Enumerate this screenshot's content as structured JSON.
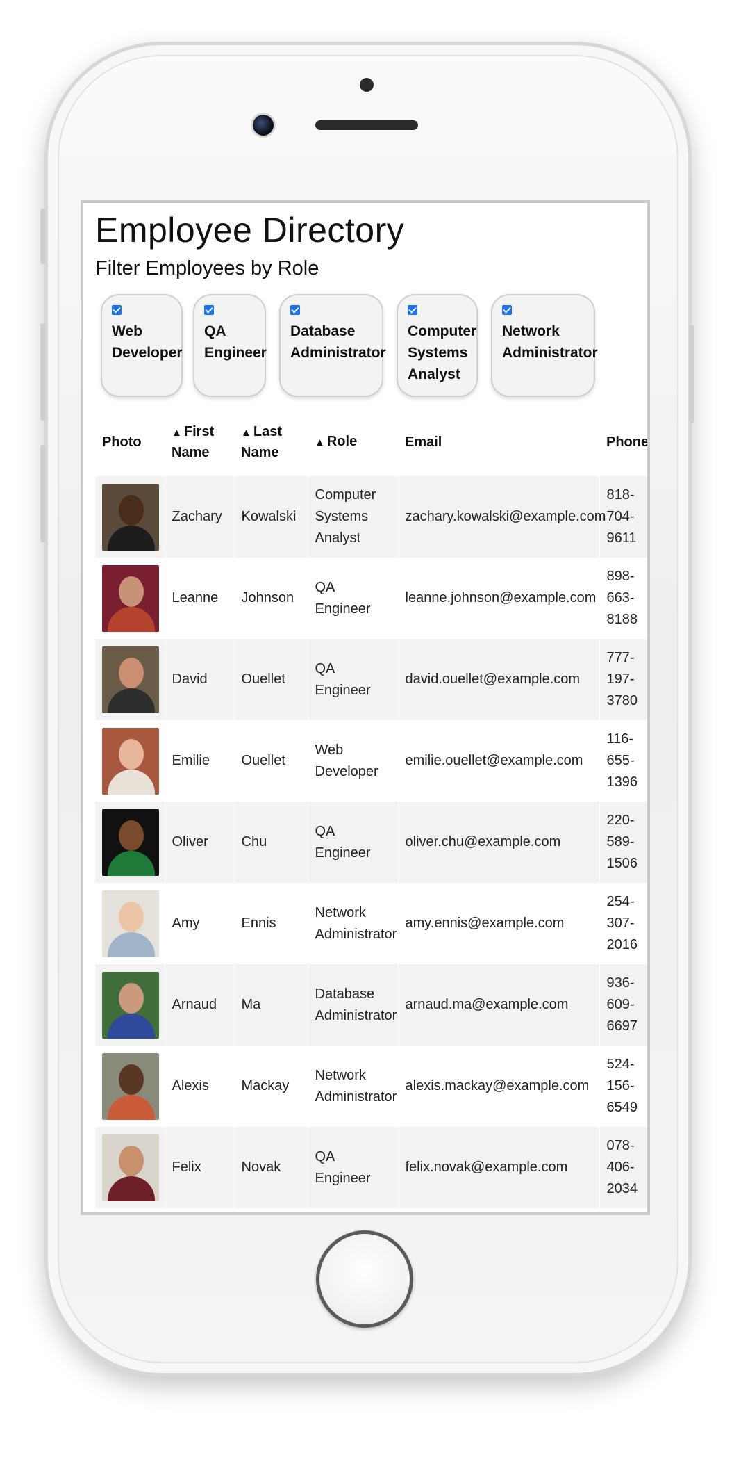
{
  "page": {
    "title": "Employee Directory",
    "subtitle": "Filter Employees by Role"
  },
  "filters": [
    {
      "lines": [
        "Web",
        "Developer"
      ],
      "checked": true
    },
    {
      "lines": [
        "QA",
        "Engineer"
      ],
      "checked": true
    },
    {
      "lines": [
        "Database",
        "Administrator"
      ],
      "checked": true
    },
    {
      "lines": [
        "Computer",
        "Systems",
        "Analyst"
      ],
      "checked": true
    },
    {
      "lines": [
        "Network",
        "Administrator"
      ],
      "checked": true
    }
  ],
  "table": {
    "headers": {
      "photo": "Photo",
      "first_name": [
        "First",
        "Name"
      ],
      "last_name": [
        "Last",
        "Name"
      ],
      "role": "Role",
      "email": "Email",
      "phone": "Phone"
    },
    "sort_icon": "sort-icon",
    "rows": [
      {
        "first": "Zachary",
        "last": "Kowalski",
        "role": [
          "Computer",
          "Systems",
          "Analyst"
        ],
        "email": "zachary.kowalski@example.com",
        "phone": [
          "818-",
          "704-",
          "9611"
        ],
        "colors": {
          "bg": "#5b4a3a",
          "skin": "#4a2c1c",
          "shirt": "#1d1d1d"
        }
      },
      {
        "first": "Leanne",
        "last": "Johnson",
        "role": [
          "QA Engineer"
        ],
        "email": "leanne.johnson@example.com",
        "phone": [
          "898-",
          "663-",
          "8188"
        ],
        "colors": {
          "bg": "#7a1f32",
          "skin": "#c79177",
          "shirt": "#b5422c"
        }
      },
      {
        "first": "David",
        "last": "Ouellet",
        "role": [
          "QA Engineer"
        ],
        "email": "david.ouellet@example.com",
        "phone": [
          "777-",
          "197-",
          "3780"
        ],
        "colors": {
          "bg": "#6a5a48",
          "skin": "#c98f70",
          "shirt": "#2e2e2e"
        }
      },
      {
        "first": "Emilie",
        "last": "Ouellet",
        "role": [
          "Web",
          "Developer"
        ],
        "email": "emilie.ouellet@example.com",
        "phone": [
          "116-",
          "655-",
          "1396"
        ],
        "colors": {
          "bg": "#a8583e",
          "skin": "#e6b59a",
          "shirt": "#e9e1d8"
        }
      },
      {
        "first": "Oliver",
        "last": "Chu",
        "role": [
          "QA Engineer"
        ],
        "email": "oliver.chu@example.com",
        "phone": [
          "220-",
          "589-",
          "1506"
        ],
        "colors": {
          "bg": "#111111",
          "skin": "#7a4a2c",
          "shirt": "#1f7a3a"
        }
      },
      {
        "first": "Amy",
        "last": "Ennis",
        "role": [
          "Network",
          "Administrator"
        ],
        "email": "amy.ennis@example.com",
        "phone": [
          "254-",
          "307-",
          "2016"
        ],
        "colors": {
          "bg": "#e4e0da",
          "skin": "#ecc4a6",
          "shirt": "#9fb4c8"
        }
      },
      {
        "first": "Arnaud",
        "last": "Ma",
        "role": [
          "Database",
          "Administrator"
        ],
        "email": "arnaud.ma@example.com",
        "phone": [
          "936-",
          "609-",
          "6697"
        ],
        "colors": {
          "bg": "#3f6e3a",
          "skin": "#c99a7c",
          "shirt": "#2f4a9a"
        }
      },
      {
        "first": "Alexis",
        "last": "Mackay",
        "role": [
          "Network",
          "Administrator"
        ],
        "email": "alexis.mackay@example.com",
        "phone": [
          "524-",
          "156-",
          "6549"
        ],
        "colors": {
          "bg": "#8a8a7a",
          "skin": "#5a3624",
          "shirt": "#c95a3a"
        }
      },
      {
        "first": "Felix",
        "last": "Novak",
        "role": [
          "QA Engineer"
        ],
        "email": "felix.novak@example.com",
        "phone": [
          "078-",
          "406-",
          "2034"
        ],
        "colors": {
          "bg": "#d8d4cc",
          "skin": "#c9906e",
          "shirt": "#6e1f2a"
        }
      }
    ]
  }
}
